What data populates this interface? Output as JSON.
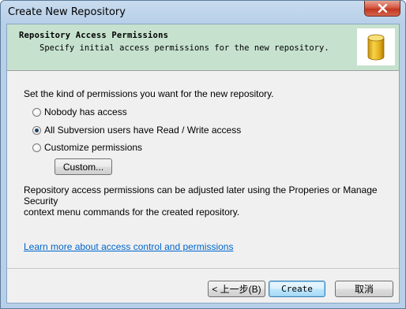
{
  "window": {
    "title": "Create New Repository"
  },
  "header": {
    "title": "Repository Access Permissions",
    "subtitle": "Specify initial access permissions for the new repository.",
    "icon": "database-cylinder-icon",
    "icon_color": "#e6b422"
  },
  "body": {
    "prompt": "Set the kind of permissions you want for the new repository.",
    "options": [
      {
        "label": "Nobody has access",
        "selected": false
      },
      {
        "label": "All Subversion users have Read / Write access",
        "selected": true
      },
      {
        "label": "Customize permissions",
        "selected": false
      }
    ],
    "custom_button": "Custom...",
    "info_line1": "Repository access permissions can be adjusted later using the Properies or Manage Security",
    "info_line2": "context menu commands for the created repository.",
    "link": "Learn more about access control and permissions"
  },
  "footer": {
    "back_button": "< 上一步(B)",
    "create_button": "Create",
    "cancel_button": "取消"
  },
  "colors": {
    "header_bg": "#c6e2cf",
    "link": "#0066cc",
    "close_button": "#c2341f"
  }
}
